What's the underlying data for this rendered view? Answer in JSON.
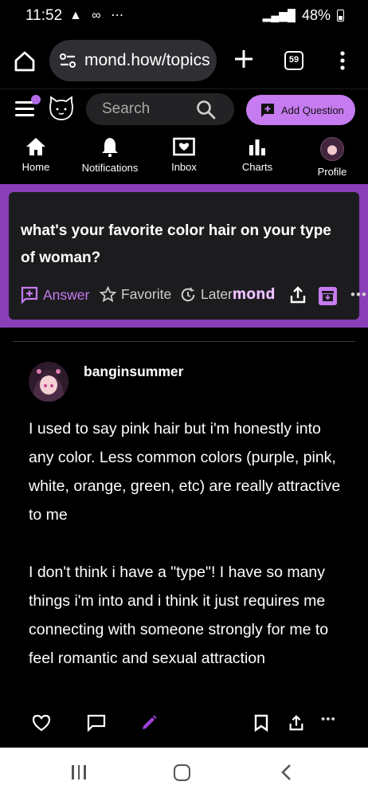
{
  "status_bar": {
    "time": "11:52",
    "left_icons": "▲ ∞ ⋯",
    "battery": "48%"
  },
  "browser": {
    "url": "mond.how/topics",
    "tab_count": "59"
  },
  "header": {
    "search_placeholder": "Search",
    "add_question_label": "Add Question"
  },
  "nav": {
    "items": [
      {
        "label": "Home",
        "icon": "home-icon"
      },
      {
        "label": "Notifications",
        "icon": "bell-icon"
      },
      {
        "label": "Inbox",
        "icon": "inbox-icon"
      },
      {
        "label": "Charts",
        "icon": "chart-icon"
      },
      {
        "label": "Profile",
        "icon": "avatar"
      }
    ]
  },
  "question": {
    "title": "what's your favorite color hair on your type of woman?",
    "actions": {
      "answer": "Answer",
      "favorite": "Favorite",
      "later": "Later",
      "brand": "mond"
    }
  },
  "answer": {
    "username": "banginsummer",
    "paragraphs": [
      "I used to say pink hair but i'm honestly into any color.  Less common colors (purple, pink, white, orange, green, etc) are really attractive to me",
      "I don't think i have a \"type\"!  I have so many things i'm into and i think it just requires me connecting with someone strongly for me to feel romantic and sexual attraction"
    ]
  },
  "colors": {
    "accent": "#c67bf0",
    "question_frame": "#8a3fb8",
    "card_bg": "#1c1c1f"
  }
}
